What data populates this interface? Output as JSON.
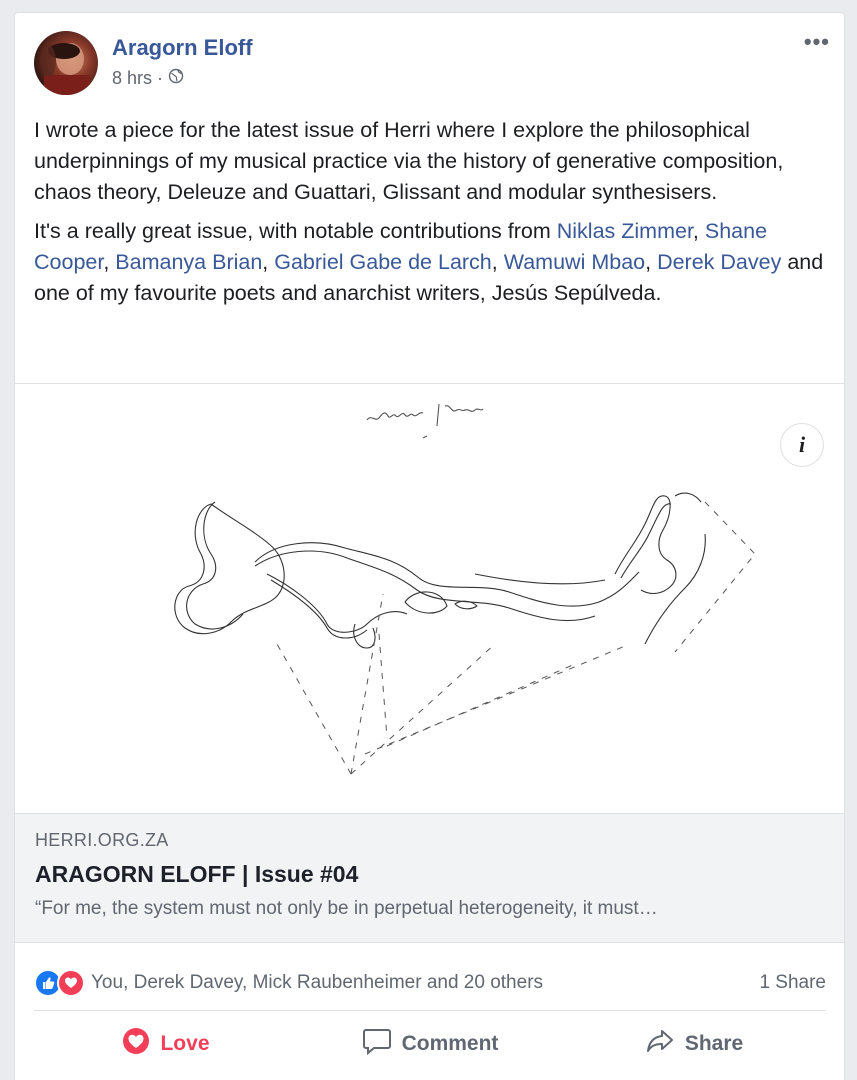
{
  "post": {
    "author": "Aragorn Eloff",
    "time": "8 hrs",
    "separator": "·",
    "privacy_icon": "globe-icon",
    "more_icon": "more-options-icon",
    "body_p1": "I wrote a piece for the latest issue of Herri where I explore the philosophical underpinnings of my musical practice via the history of generative composition, chaos theory, Deleuze and Guattari, Glissant and modular synthesisers.",
    "body_p2_intro": "It's a really great issue, with notable contributions from ",
    "tags": [
      "Niklas Zimmer",
      "Shane Cooper",
      "Bamanya Brian",
      "Gabriel Gabe de Larch",
      "Wamuwi Mbao",
      "Derek Davey"
    ],
    "sep_comma": ", ",
    "body_p2_outro": " and one of my favourite poets and anarchist writers, Jesús Sepúlveda."
  },
  "media": {
    "image_caption": "edouard glissant"
  },
  "link_preview": {
    "domain": "HERRI.ORG.ZA",
    "title": "ARAGORN ELOFF | Issue #04",
    "description": "“For me, the system must not only be in perpetual heterogeneity, it must…"
  },
  "reactions": {
    "summary": "You, Derek Davey, Mick Raubenheimer and 20 others",
    "shares": "1 Share"
  },
  "actions": {
    "love": "Love",
    "comment": "Comment",
    "share": "Share"
  },
  "colors": {
    "link": "#385898",
    "love": "#f33e58",
    "like": "#1877f2"
  }
}
